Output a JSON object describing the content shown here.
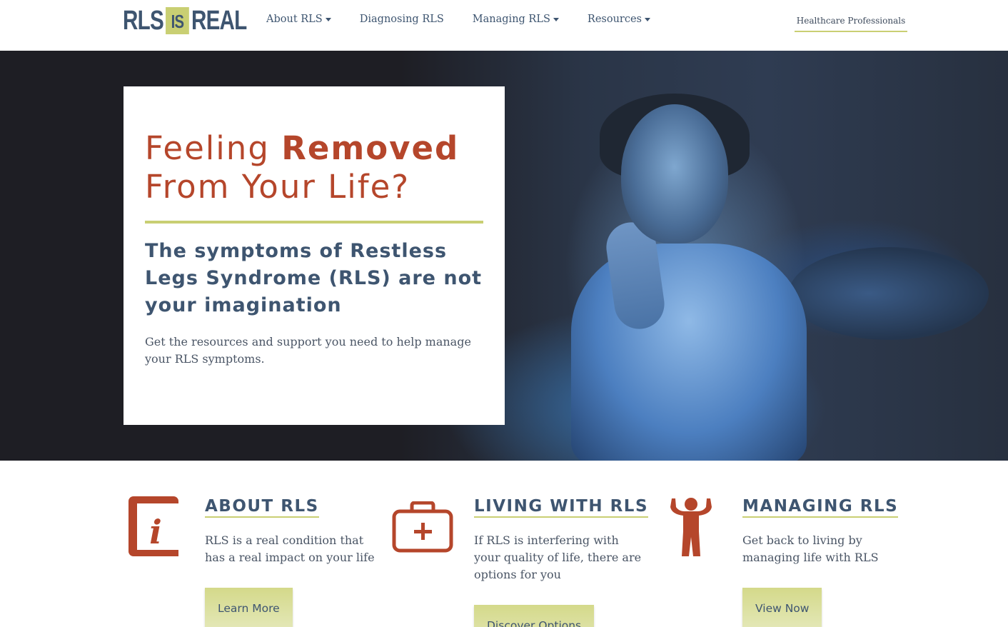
{
  "header": {
    "logo": {
      "part1": "RLS",
      "part2": "IS",
      "part3": "REAL"
    },
    "nav": [
      {
        "label": "About RLS",
        "has_dropdown": true
      },
      {
        "label": "Diagnosing RLS",
        "has_dropdown": false
      },
      {
        "label": "Managing RLS",
        "has_dropdown": true
      },
      {
        "label": "Resources",
        "has_dropdown": true
      }
    ],
    "hcp_link": "Healthcare Professionals"
  },
  "hero": {
    "title_light_1": "Feeling ",
    "title_bold": "Removed",
    "title_light_2": "From Your Life?",
    "subtitle": "The symptoms of Restless Legs Syndrome (RLS) are not your imagination",
    "body": "Get the resources and support you need to help manage your RLS symptoms."
  },
  "features": [
    {
      "icon": "info-book-icon",
      "title": "ABOUT RLS",
      "text": "RLS is a real condition that has a real impact on your life",
      "button": "Learn More"
    },
    {
      "icon": "first-aid-kit-icon",
      "title": "LIVING WITH RLS",
      "text": "If RLS is interfering with your quality of life, there are options for you",
      "button": "Discover Options"
    },
    {
      "icon": "cheering-person-icon",
      "title": "MANAGING RLS",
      "text": "Get back to living by managing life with RLS",
      "button": "View Now"
    }
  ],
  "colors": {
    "brand_navy": "#3e5570",
    "accent_rust": "#b5462b",
    "accent_lime": "#c9cf73"
  }
}
